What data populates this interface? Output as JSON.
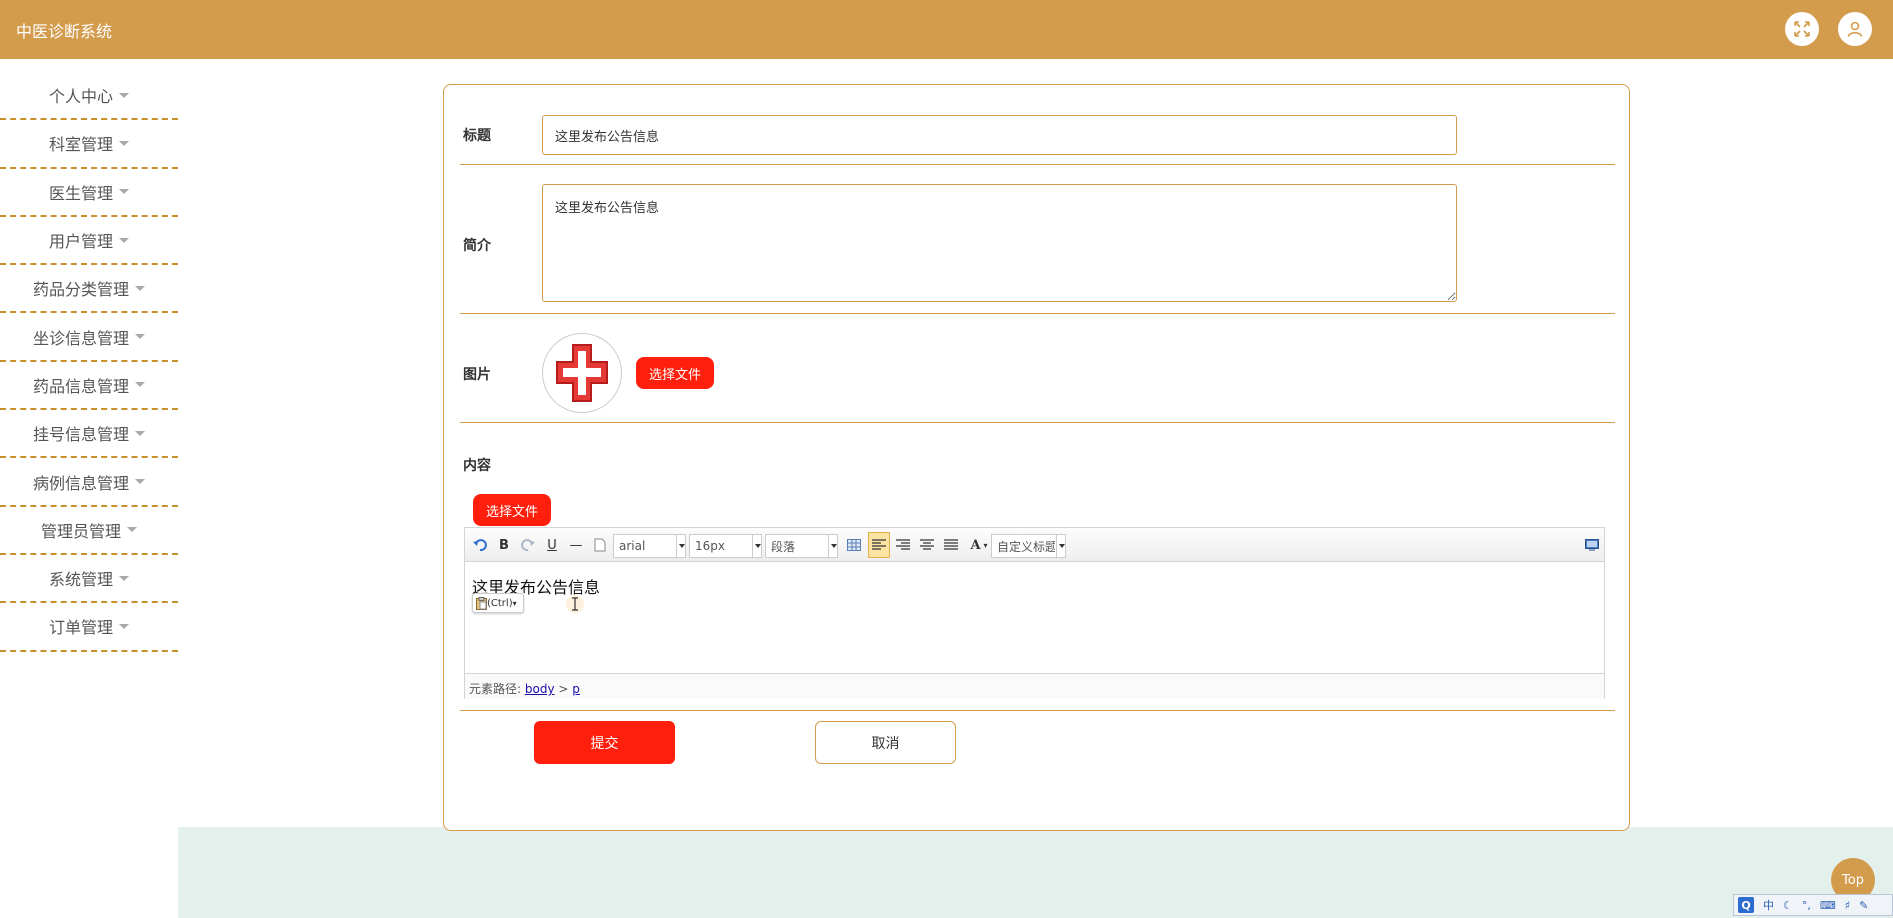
{
  "header": {
    "title": "中医诊断系统"
  },
  "sidebar": {
    "items": [
      {
        "label": "个人中心"
      },
      {
        "label": "科室管理"
      },
      {
        "label": "医生管理"
      },
      {
        "label": "用户管理"
      },
      {
        "label": "药品分类管理"
      },
      {
        "label": "坐诊信息管理"
      },
      {
        "label": "药品信息管理"
      },
      {
        "label": "挂号信息管理"
      },
      {
        "label": "病例信息管理"
      },
      {
        "label": "管理员管理"
      },
      {
        "label": "系统管理"
      },
      {
        "label": "订单管理"
      }
    ]
  },
  "form": {
    "title_label": "标题",
    "title_value": "这里发布公告信息",
    "intro_label": "简介",
    "intro_value": "这里发布公告信息",
    "picture_label": "图片",
    "choose_file": "选择文件",
    "content_label": "内容",
    "submit": "提交",
    "cancel": "取消"
  },
  "editor": {
    "font_family": "arial",
    "font_size": "16px",
    "paragraph": "段落",
    "custom_title": "自定义标题",
    "content_text": "这里发布公告信息",
    "paste_tip": "(Ctrl)",
    "path_label": "元素路径:",
    "path_body": "body",
    "path_sep": ">",
    "path_p": "p"
  },
  "top_button": "Top",
  "tray": {
    "ime": "中"
  },
  "colors": {
    "header": "#d39b4c",
    "accent_red": "#ff1f0c",
    "bottom_band": "#e4f0ec"
  }
}
